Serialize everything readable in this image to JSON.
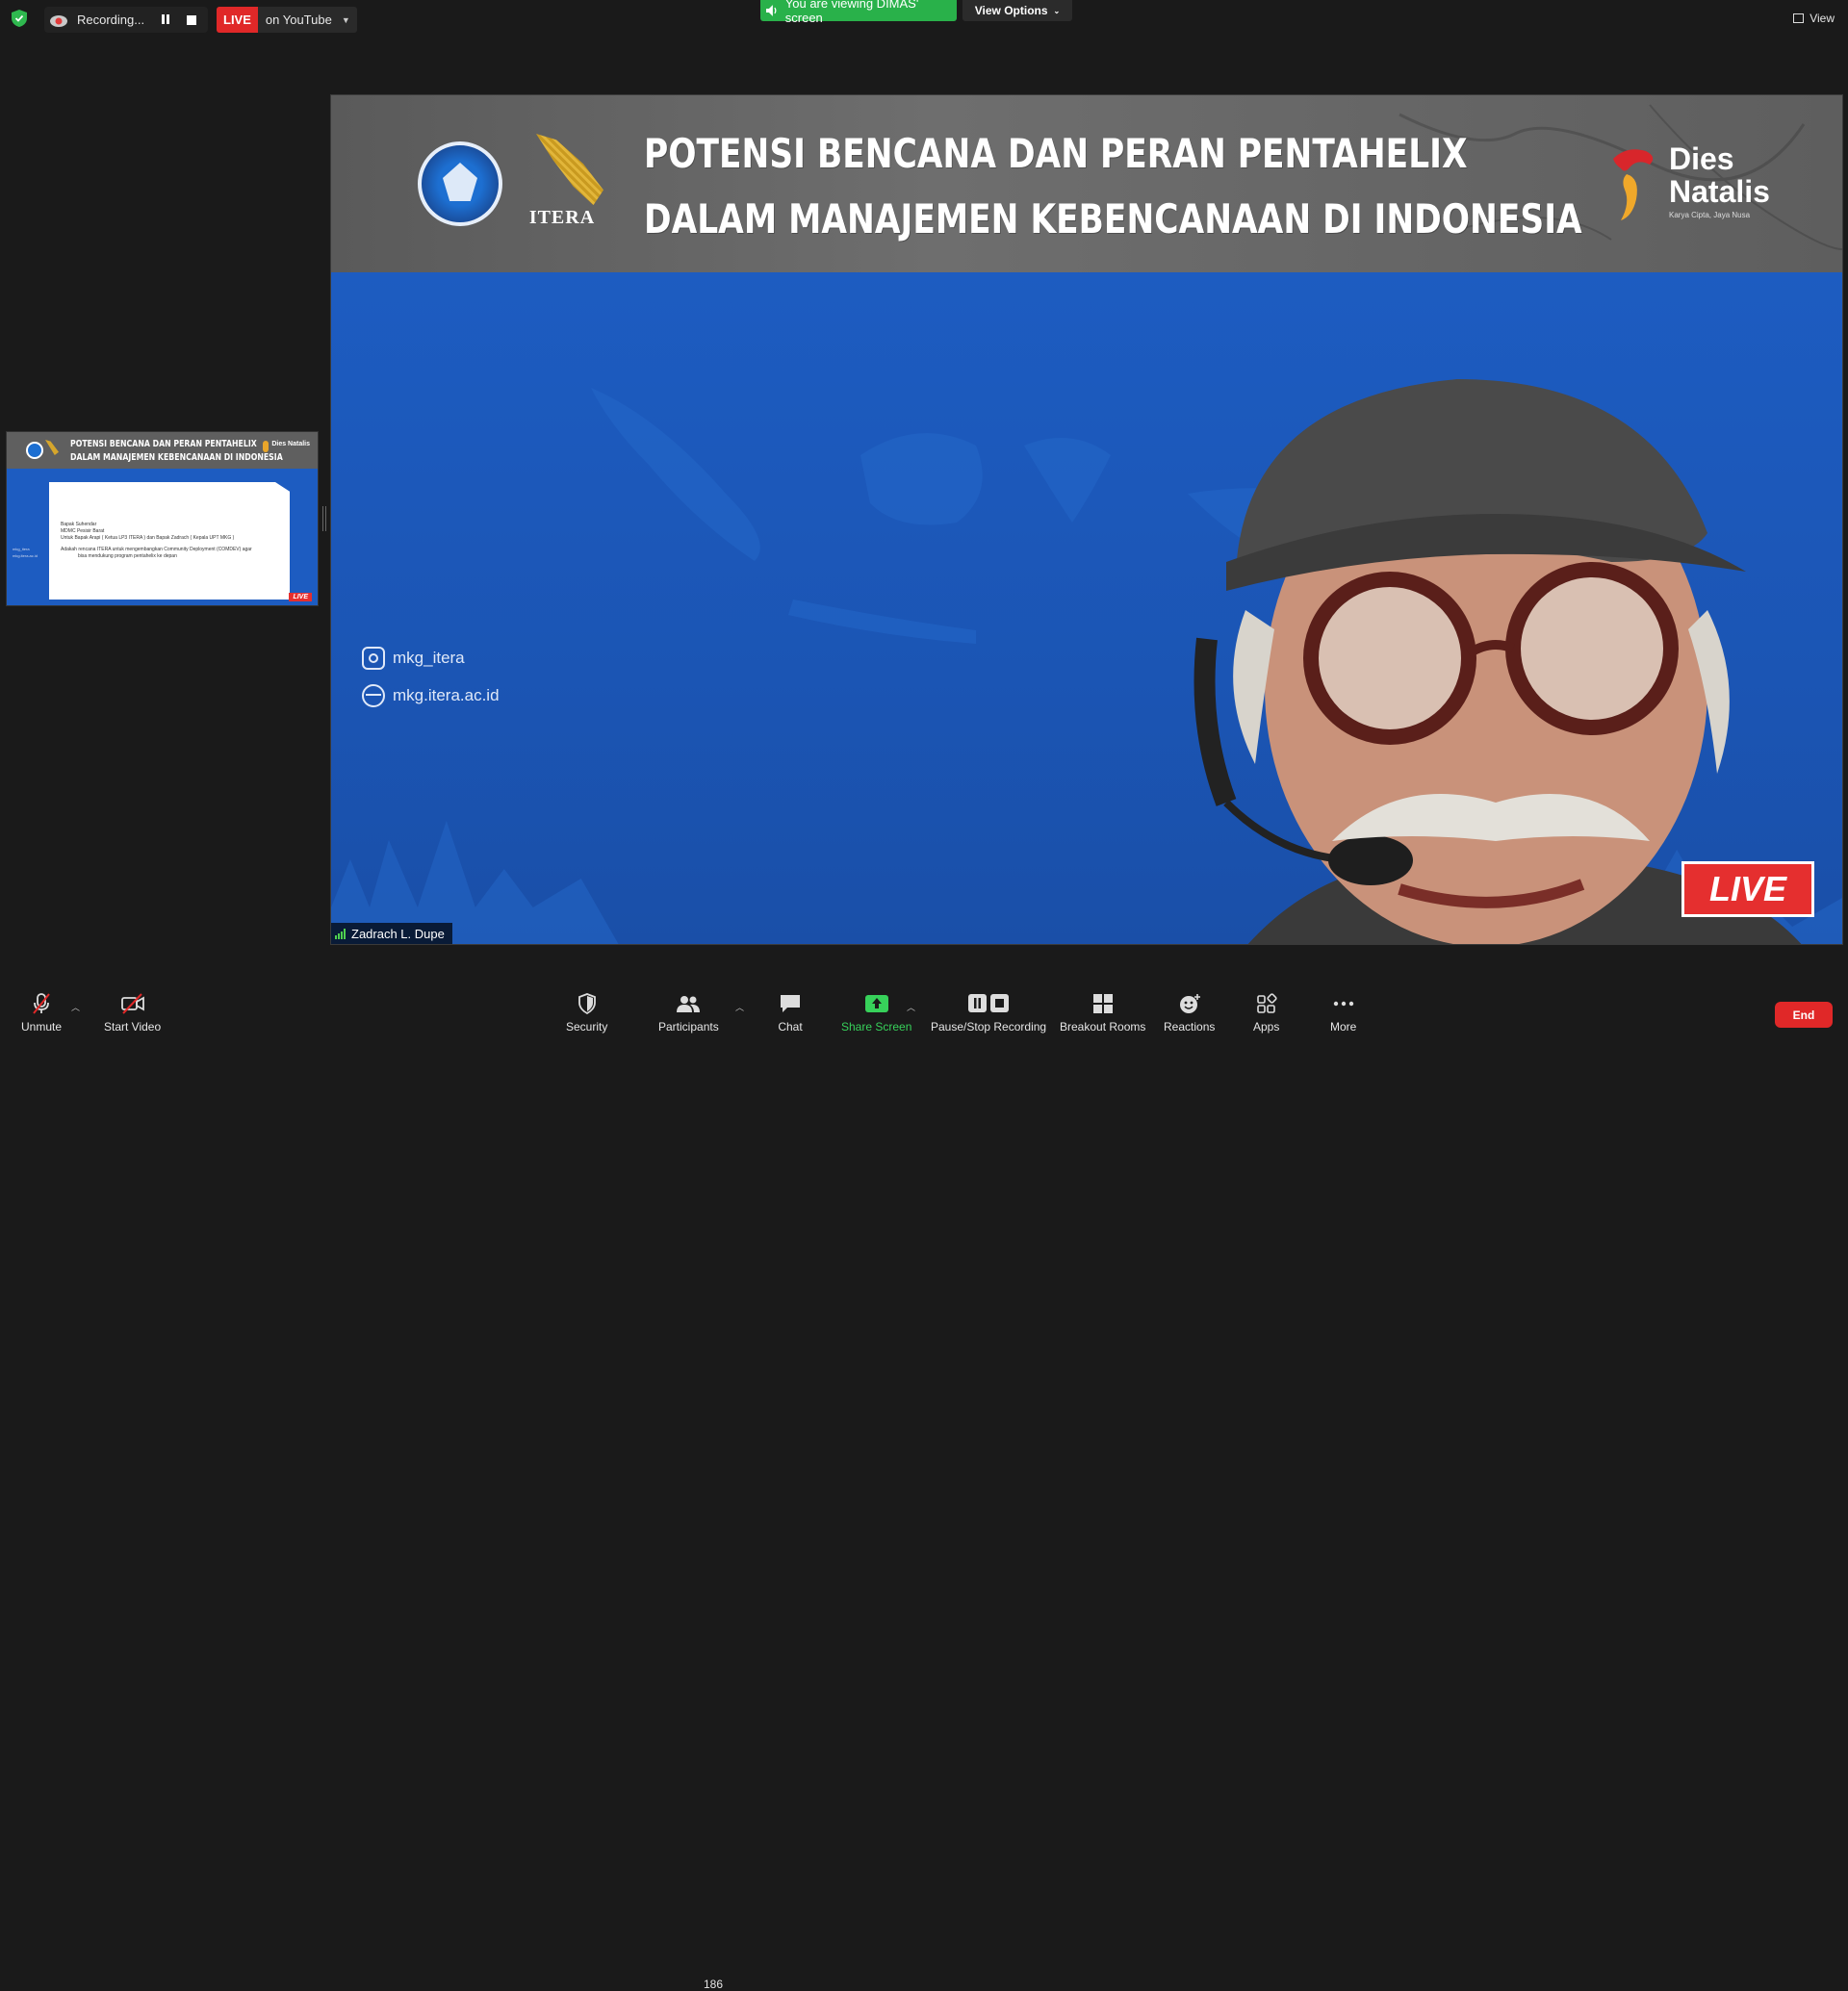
{
  "topbar": {
    "recording_label": "Recording...",
    "live_label": "LIVE",
    "stream_target": "on YouTube",
    "viewing_banner": "You are viewing DIMAS' screen",
    "view_options": "View Options",
    "view_label": "View"
  },
  "share": {
    "title_line1": "POTENSI BENCANA DAN PERAN PENTAHELIX",
    "title_line2": "DALAM MANAJEMEN KEBENCANAAN DI INDONESIA",
    "itera_logo_text": "ITERA",
    "dies_line1": "Dies",
    "dies_line2": "Natalis",
    "dies_tagline": "Karya Cipta, Jaya Nusa",
    "instagram": "mkg_itera",
    "website": "mkg.itera.ac.id",
    "live_badge": "LIVE",
    "speaker_name": "Zadrach L. Dupe"
  },
  "thumbnail": {
    "title_line1": "POTENSI BENCANA DAN PERAN PENTAHELIX",
    "title_line2": "DALAM MANAJEMEN KEBENCANAAN DI INDONESIA",
    "dies": "Dies Natalis",
    "doc_lines": [
      "Bapak Suhendar",
      "MDMC Pesisir Barat",
      "Untuk Bapak Arapi ( Ketua LP3 ITERA ) dan Bapak Zadrach ( Kepala UPT MKG )",
      "Adakah rencana ITERA untuk mengembangkan Community Deployment (COMDEV) agar",
      "bisa mendukung program pentahelix ke depan"
    ],
    "live": "LIVE",
    "side_lines": [
      "mkg_itera",
      "mkg.itera.ac.id"
    ]
  },
  "toolbar": {
    "unmute": "Unmute",
    "start_video": "Start Video",
    "security": "Security",
    "participants": "Participants",
    "participants_count": "186",
    "chat": "Chat",
    "share_screen": "Share Screen",
    "pause_stop_recording": "Pause/Stop Recording",
    "breakout_rooms": "Breakout Rooms",
    "reactions": "Reactions",
    "apps": "Apps",
    "more": "More",
    "end": "End"
  },
  "colors": {
    "share_blue": "#1c58b8",
    "banner_green": "#29b14a",
    "live_red": "#e02828",
    "share_screen_green": "#37d15a"
  }
}
